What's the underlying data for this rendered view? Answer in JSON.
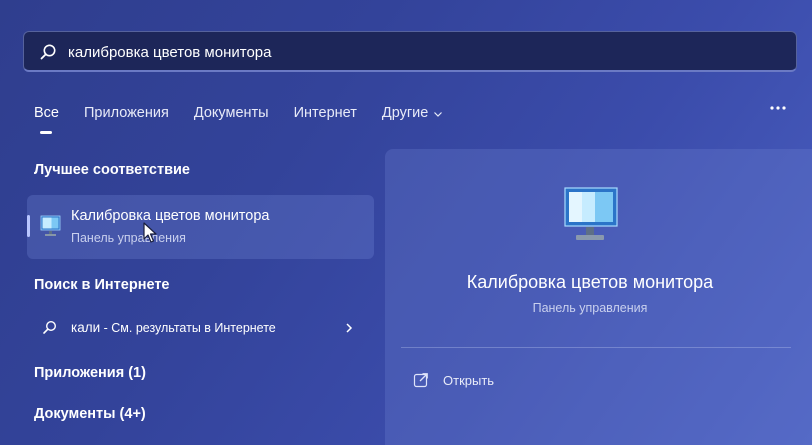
{
  "search": {
    "query": "калибровка цветов монитора"
  },
  "tabs": [
    {
      "label": "Все",
      "active": true
    },
    {
      "label": "Приложения"
    },
    {
      "label": "Документы"
    },
    {
      "label": "Интернет"
    },
    {
      "label": "Другие"
    }
  ],
  "more_icon": "more-horizontal-icon",
  "best_match": {
    "heading": "Лучшее соответствие",
    "title": "Калибровка цветов монитора",
    "subtitle": "Панель управления",
    "icon": "monitor-icon"
  },
  "web_search": {
    "heading": "Поиск в Интернете",
    "query": "кали",
    "suffix": " - См. результаты в Интернете"
  },
  "apps": {
    "heading": "Приложения (1)"
  },
  "documents": {
    "heading": "Документы (4+)"
  },
  "preview": {
    "title": "Калибровка цветов монитора",
    "subtitle": "Панель управления",
    "open_label": "Открыть",
    "icon": "monitor-icon"
  },
  "colors": {
    "background": "#3443a0",
    "search_bar": "#1d2659",
    "accent": "#b9c6ff"
  }
}
